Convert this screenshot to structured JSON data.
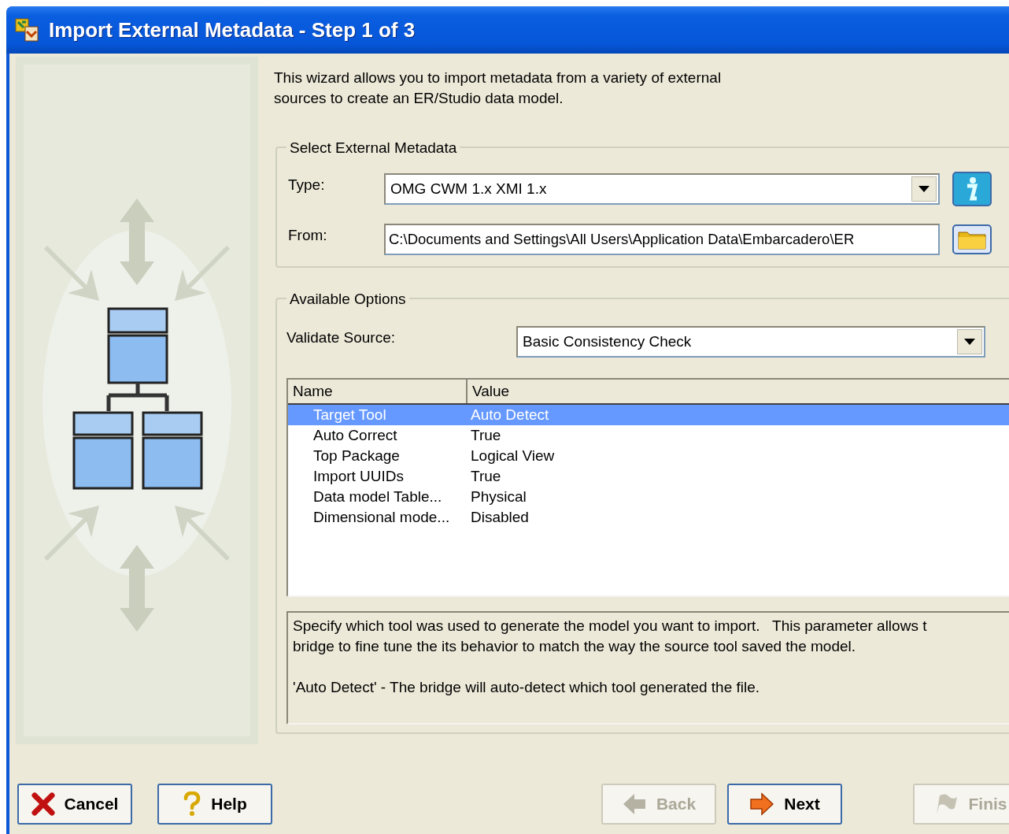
{
  "window": {
    "title": "Import External Metadata - Step 1 of 3"
  },
  "intro": "This wizard allows you to import metadata from a variety of external sources to create an ER/Studio data model.",
  "select_group": {
    "legend": "Select External Metadata",
    "type": {
      "label": "Type:",
      "value": "OMG CWM 1.x XMI 1.x"
    },
    "from": {
      "label": "From:",
      "value": "C:\\Documents and Settings\\All Users\\Application Data\\Embarcadero\\ER"
    }
  },
  "options_group": {
    "legend": "Available Options",
    "validate": {
      "label": "Validate Source:",
      "value": "Basic Consistency Check"
    },
    "table": {
      "columns": [
        "Name",
        "Value"
      ],
      "rows": [
        {
          "name": "Target Tool",
          "value": "Auto Detect",
          "selected": true
        },
        {
          "name": "Auto Correct",
          "value": "True",
          "selected": false
        },
        {
          "name": "Top Package",
          "value": "Logical View",
          "selected": false
        },
        {
          "name": "Import UUIDs",
          "value": "True",
          "selected": false
        },
        {
          "name": "Data model Table...",
          "value": "Physical",
          "selected": false
        },
        {
          "name": "Dimensional mode...",
          "value": "Disabled",
          "selected": false
        }
      ]
    },
    "description": [
      {
        "lines": [
          "Specify which tool was used to generate the model you want to import.   This parameter allows t",
          "bridge to fine tune the its behavior to match the way the source tool saved the model."
        ]
      },
      {
        "lines": [
          "'Auto Detect' - The bridge will auto-detect which tool generated the file."
        ]
      }
    ]
  },
  "buttons_left": [
    {
      "label": "Cancel",
      "kind": "cancel",
      "disabled": false
    },
    {
      "label": "Help",
      "kind": "help",
      "disabled": false
    }
  ],
  "buttons_right": [
    {
      "label": "Back",
      "kind": "back",
      "disabled": true
    },
    {
      "label": "Next",
      "kind": "next",
      "disabled": false
    },
    {
      "label": "Finis",
      "kind": "finish",
      "disabled": true
    }
  ]
}
